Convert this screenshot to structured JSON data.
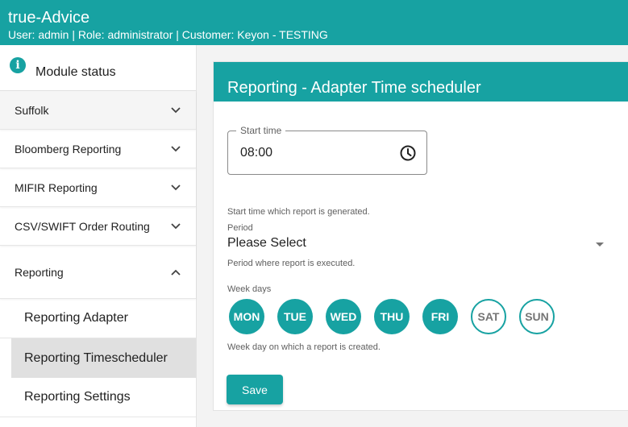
{
  "header": {
    "title": "true-Advice",
    "user_line": "User: admin | Role: administrator | Customer: Keyon - TESTING"
  },
  "sidebar": {
    "module_status": "Module status",
    "items": [
      {
        "label": "Suffolk",
        "expanded": false
      },
      {
        "label": "Bloomberg Reporting",
        "expanded": false
      },
      {
        "label": "MIFIR Reporting",
        "expanded": false
      },
      {
        "label": "CSV/SWIFT Order Routing",
        "expanded": false
      },
      {
        "label": "Reporting",
        "expanded": true
      }
    ],
    "sub_items": [
      {
        "label": "Reporting Adapter",
        "selected": false
      },
      {
        "label": "Reporting Timescheduler",
        "selected": true
      },
      {
        "label": "Reporting Settings",
        "selected": false
      }
    ]
  },
  "card": {
    "title": "Reporting - Adapter Time scheduler",
    "start_time": {
      "label": "Start time",
      "value": "08:00",
      "helper": "Start time which report is generated."
    },
    "period": {
      "label": "Period",
      "value": "Please Select",
      "helper": "Period where report is executed."
    },
    "week_days": {
      "label": "Week days",
      "days": [
        {
          "label": "MON",
          "selected": true
        },
        {
          "label": "TUE",
          "selected": true
        },
        {
          "label": "WED",
          "selected": true
        },
        {
          "label": "THU",
          "selected": true
        },
        {
          "label": "FRI",
          "selected": true
        },
        {
          "label": "SAT",
          "selected": false
        },
        {
          "label": "SUN",
          "selected": false
        }
      ],
      "helper": "Week day on which a report is created."
    },
    "save_label": "Save"
  },
  "colors": {
    "accent": "#17a2a2"
  }
}
